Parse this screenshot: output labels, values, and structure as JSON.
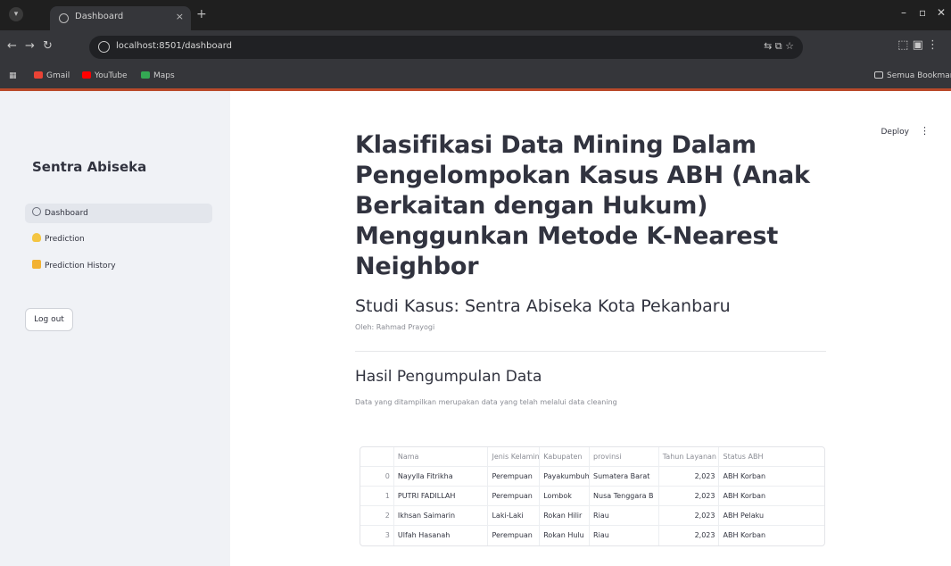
{
  "browser": {
    "tab_title": "Dashboard",
    "url": "localhost:8501/dashboard",
    "bookmarks": [
      {
        "label": "Gmail",
        "color": "#ea4335"
      },
      {
        "label": "YouTube",
        "color": "#ff0000"
      },
      {
        "label": "Maps",
        "color": "#34a853"
      }
    ],
    "all_bookmarks_label": "Semua Bookmark"
  },
  "sidebar": {
    "brand": "Sentra Abiseka",
    "items": [
      {
        "label": "Dashboard",
        "icon": "dashboard-icon",
        "active": true
      },
      {
        "label": "Prediction",
        "icon": "lightbulb-icon",
        "active": false
      },
      {
        "label": "Prediction History",
        "icon": "folder-icon",
        "active": false
      }
    ],
    "logout_label": "Log out"
  },
  "header": {
    "deploy_label": "Deploy",
    "menu_icon": "kebab-icon"
  },
  "main": {
    "title": "Klasifikasi Data Mining Dalam Pengelompokan Kasus ABH (Anak Berkaitan dengan Hukum) Menggunkan Metode K-Nearest Neighbor",
    "subtitle": "Studi Kasus: Sentra Abiseka Kota Pekanbaru",
    "author": "Oleh: Rahmad Prayogi",
    "section_title": "Hasil Pengumpulan Data",
    "section_caption": "Data yang ditampilkan merupakan data yang telah melalui data cleaning"
  },
  "table": {
    "columns": [
      "",
      "Nama",
      "Jenis Kelamin",
      "Kabupaten",
      "provinsi",
      "Tahun Layanan",
      "Status ABH"
    ],
    "rows": [
      [
        "0",
        "Nayylla Fitrikha",
        "Perempuan",
        "Payakumbuh",
        "Sumatera Barat",
        "2,023",
        "ABH Korban"
      ],
      [
        "1",
        "PUTRI FADILLAH",
        "Perempuan",
        "Lombok",
        "Nusa Tenggara B",
        "2,023",
        "ABH Korban"
      ],
      [
        "2",
        "Ikhsan Saimarin",
        "Laki-Laki",
        "Rokan Hilir",
        "Riau",
        "2,023",
        "ABH Pelaku"
      ],
      [
        "3",
        "Ulfah Hasanah",
        "Perempuan",
        "Rokan Hulu",
        "Riau",
        "2,023",
        "ABH Korban"
      ]
    ]
  },
  "colors": {
    "sidebar_bg": "#f0f2f6",
    "text": "#31333f",
    "chrome_dark": "#1f1f1f",
    "loading_accent": "#b94a2a"
  }
}
